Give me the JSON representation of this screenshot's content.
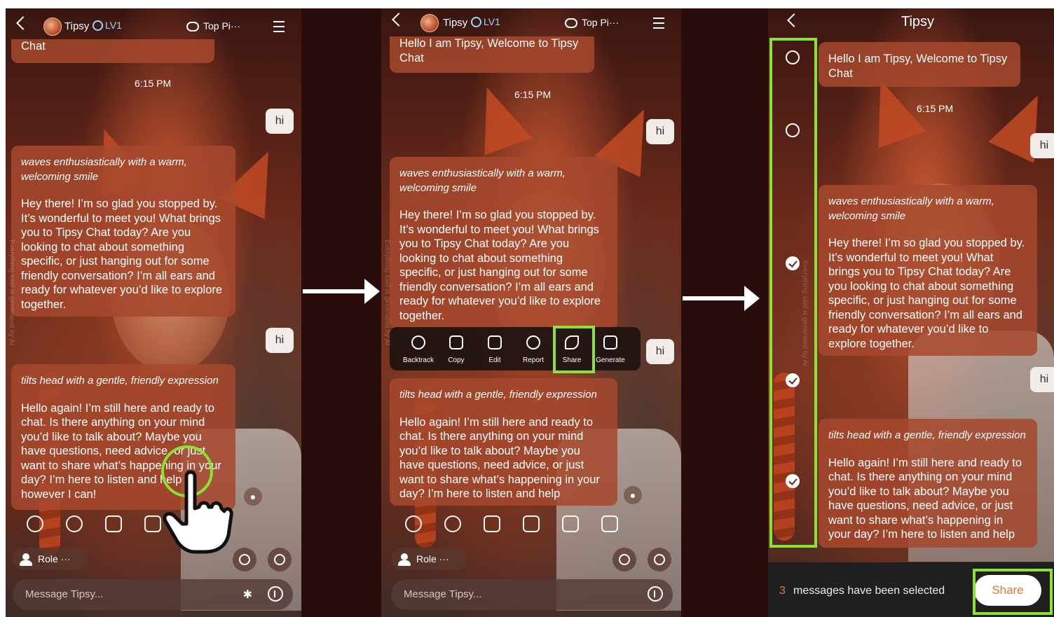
{
  "panel1": {
    "header": {
      "name": "Tipsy",
      "level": "LV1",
      "topics": "Top Pi···"
    },
    "prev_bubble_tail": "Chat",
    "time": "6:15 PM",
    "user_msgs": [
      "hi",
      "hi"
    ],
    "ai_msg1": {
      "action": "waves enthusiastically with a warm, welcoming smile",
      "text": "Hey there! I’m so glad you stopped by. It’s wonderful to meet you! What brings you to Tipsy Chat today? Are you looking to chat about something specific, or just hanging out for some friendly conversation? I’m all ears and ready for whatever you’d like to explore together."
    },
    "ai_msg2": {
      "action": "tilts head with a gentle, friendly expression",
      "text": "Hello again! I’m still here and ready to chat. Is there anything on your mind you’d like to talk about? Maybe you have questions, need advice, or just want to share what’s happening in your day? I’m here to listen and help however I can!"
    },
    "role_label": "Role ···",
    "message_placeholder": "Message Tipsy...",
    "watermark": "Everything said is generated by AI"
  },
  "panel2": {
    "header": {
      "name": "Tipsy",
      "level": "LV1",
      "topics": "Top Pi···"
    },
    "prev_bubble_tail": "Hello I am Tipsy, Welcome to Tipsy Chat",
    "time": "6:15 PM",
    "user_msgs": [
      "hi",
      "hi"
    ],
    "ai_msg1": {
      "action": "waves enthusiastically with a warm, welcoming smile",
      "text": "Hey there! I’m so glad you stopped by. It’s wonderful to meet you! What brings you to Tipsy Chat today? Are you looking to chat about something specific, or just hanging out for some friendly conversation? I’m all ears and ready for whatever you’d like to explore together."
    },
    "ai_msg2": {
      "action": "tilts head with a gentle, friendly expression",
      "text": "Hello again! I’m still here and ready to chat. Is there anything on your mind you’d like to talk about? Maybe you have questions, need advice, or just want to share what’s happening in your day? I’m here to listen and help"
    },
    "toolbar": [
      "Backtrack",
      "Copy",
      "Edit",
      "Report",
      "Share",
      "Generate"
    ],
    "role_label": "Role ···",
    "message_placeholder": "Message Tipsy...",
    "watermark": "Everything said is generated by AI"
  },
  "panel3": {
    "title": "Tipsy",
    "greeting": "Hello I am Tipsy, Welcome to Tipsy Chat",
    "time": "6:15 PM",
    "user_msgs": [
      "hi",
      "hi"
    ],
    "ai_msg1": {
      "action": "waves enthusiastically with a warm, welcoming smile",
      "text": "Hey there! I’m so glad you stopped by. It’s wonderful to meet you! What brings you to Tipsy Chat today? Are you looking to chat about something specific, or just hanging out for some friendly conversation? I’m all ears and ready for whatever you’d like to explore together."
    },
    "ai_msg2": {
      "action": "tilts head with a gentle, friendly expression",
      "text": "Hello again! I’m still here and ready to chat. Is there anything on your mind you’d like to talk about? Maybe you have questions, need advice, or just want to share what’s happening in your day? I’m here to listen and help"
    },
    "selected_count": "3",
    "selected_text": "messages have been selected",
    "share_button": "Share",
    "watermark": "Everything said is generated by AI"
  },
  "colors": {
    "highlight": "#8ae234",
    "accent": "#e57832",
    "bubble": "#a6482d"
  }
}
